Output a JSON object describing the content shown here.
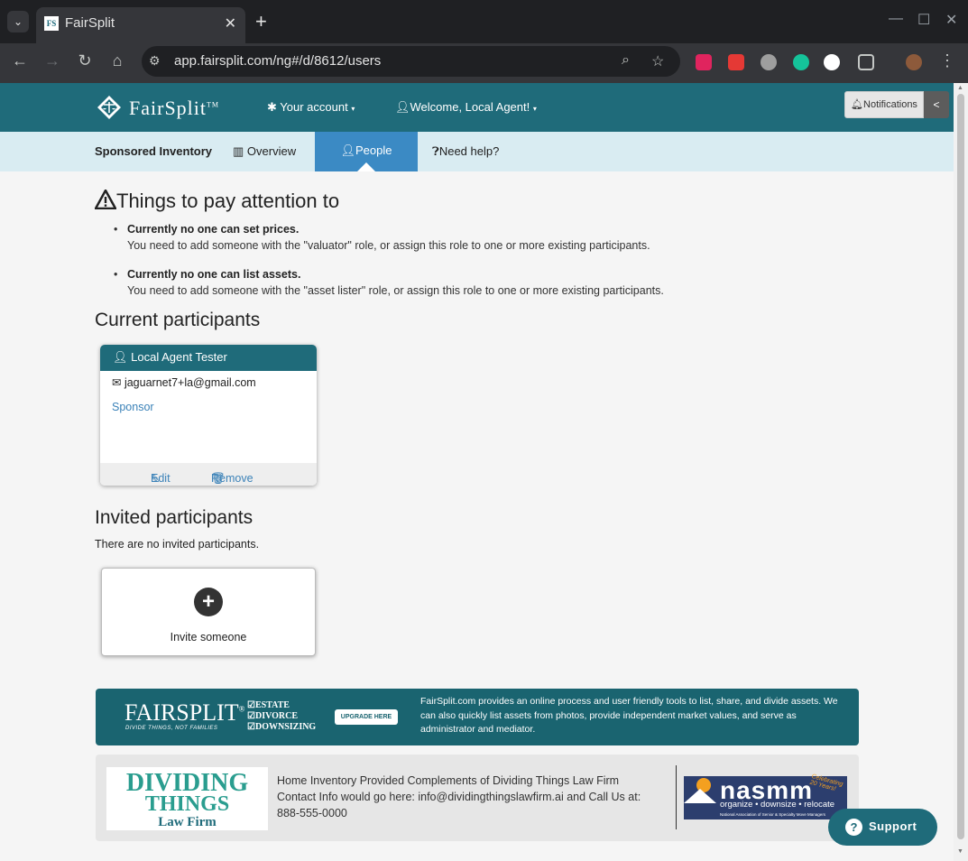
{
  "browser": {
    "tab_title": "FairSplit",
    "tab_favicon": "FS",
    "url": "app.fairsplit.com/ng#/d/8612/users",
    "newtab_label": "+",
    "close_label": "✕"
  },
  "header": {
    "brand": "FairSplit",
    "tm": "TM",
    "your_account": "Your account",
    "welcome": "Welcome, Local Agent!",
    "notifications": "Notifications",
    "collapse": "<"
  },
  "subnav": {
    "title": "Sponsored Inventory",
    "overview": "Overview",
    "people": "People",
    "help": "Need help?"
  },
  "attention": {
    "heading": "Things to pay attention to",
    "items": [
      {
        "title": "Currently no one can set prices.",
        "body": "You need to add someone with the \"valuator\" role, or assign this role to one or more existing participants."
      },
      {
        "title": "Currently no one can list assets.",
        "body": "You need to add someone with the \"asset lister\" role, or assign this role to one or more existing participants."
      }
    ]
  },
  "current": {
    "heading": "Current participants",
    "participant": {
      "name": "Local Agent Tester",
      "email": "jaguarnet7+la@gmail.com",
      "role": "Sponsor",
      "edit": "Edit",
      "remove": "Remove"
    }
  },
  "invited": {
    "heading": "Invited participants",
    "empty": "There are no invited participants.",
    "invite_label": "Invite someone"
  },
  "ad_fairsplit": {
    "logo": "FAIRSPLIT",
    "reg": "®",
    "tagline": "DIVIDE THINGS, NOT FAMILIES",
    "services": [
      "ESTATE",
      "DIVORCE",
      "DOWNSIZING"
    ],
    "button": "UPGRADE HERE",
    "text": "FairSplit.com provides an online process and user friendly tools to list, share, and divide assets. We can also quickly list assets from photos, provide independent market values, and serve as administrator and mediator."
  },
  "ad_dt": {
    "logo_line1": "DIVIDING",
    "logo_line2": "THINGS",
    "logo_line3": "Law Firm",
    "line1": "Home Inventory Provided Complements of Dividing Things Law Firm",
    "line2": "Contact Info would go here: info@dividingthingslawfirm.ai and Call Us at:",
    "line3": "888-555-0000",
    "nasmm": "nasmm",
    "nasmm_sub": "organize • downsize • relocate",
    "nasmm_full": "National Association of Senior & Specialty Move Managers",
    "nasmm_celebrating": "Celebrating 20 Years!"
  },
  "support": {
    "label": "Support"
  },
  "colors": {
    "brand": "#1f6b7a",
    "active_tab": "#3b8ac4",
    "link": "#3b82b8"
  }
}
